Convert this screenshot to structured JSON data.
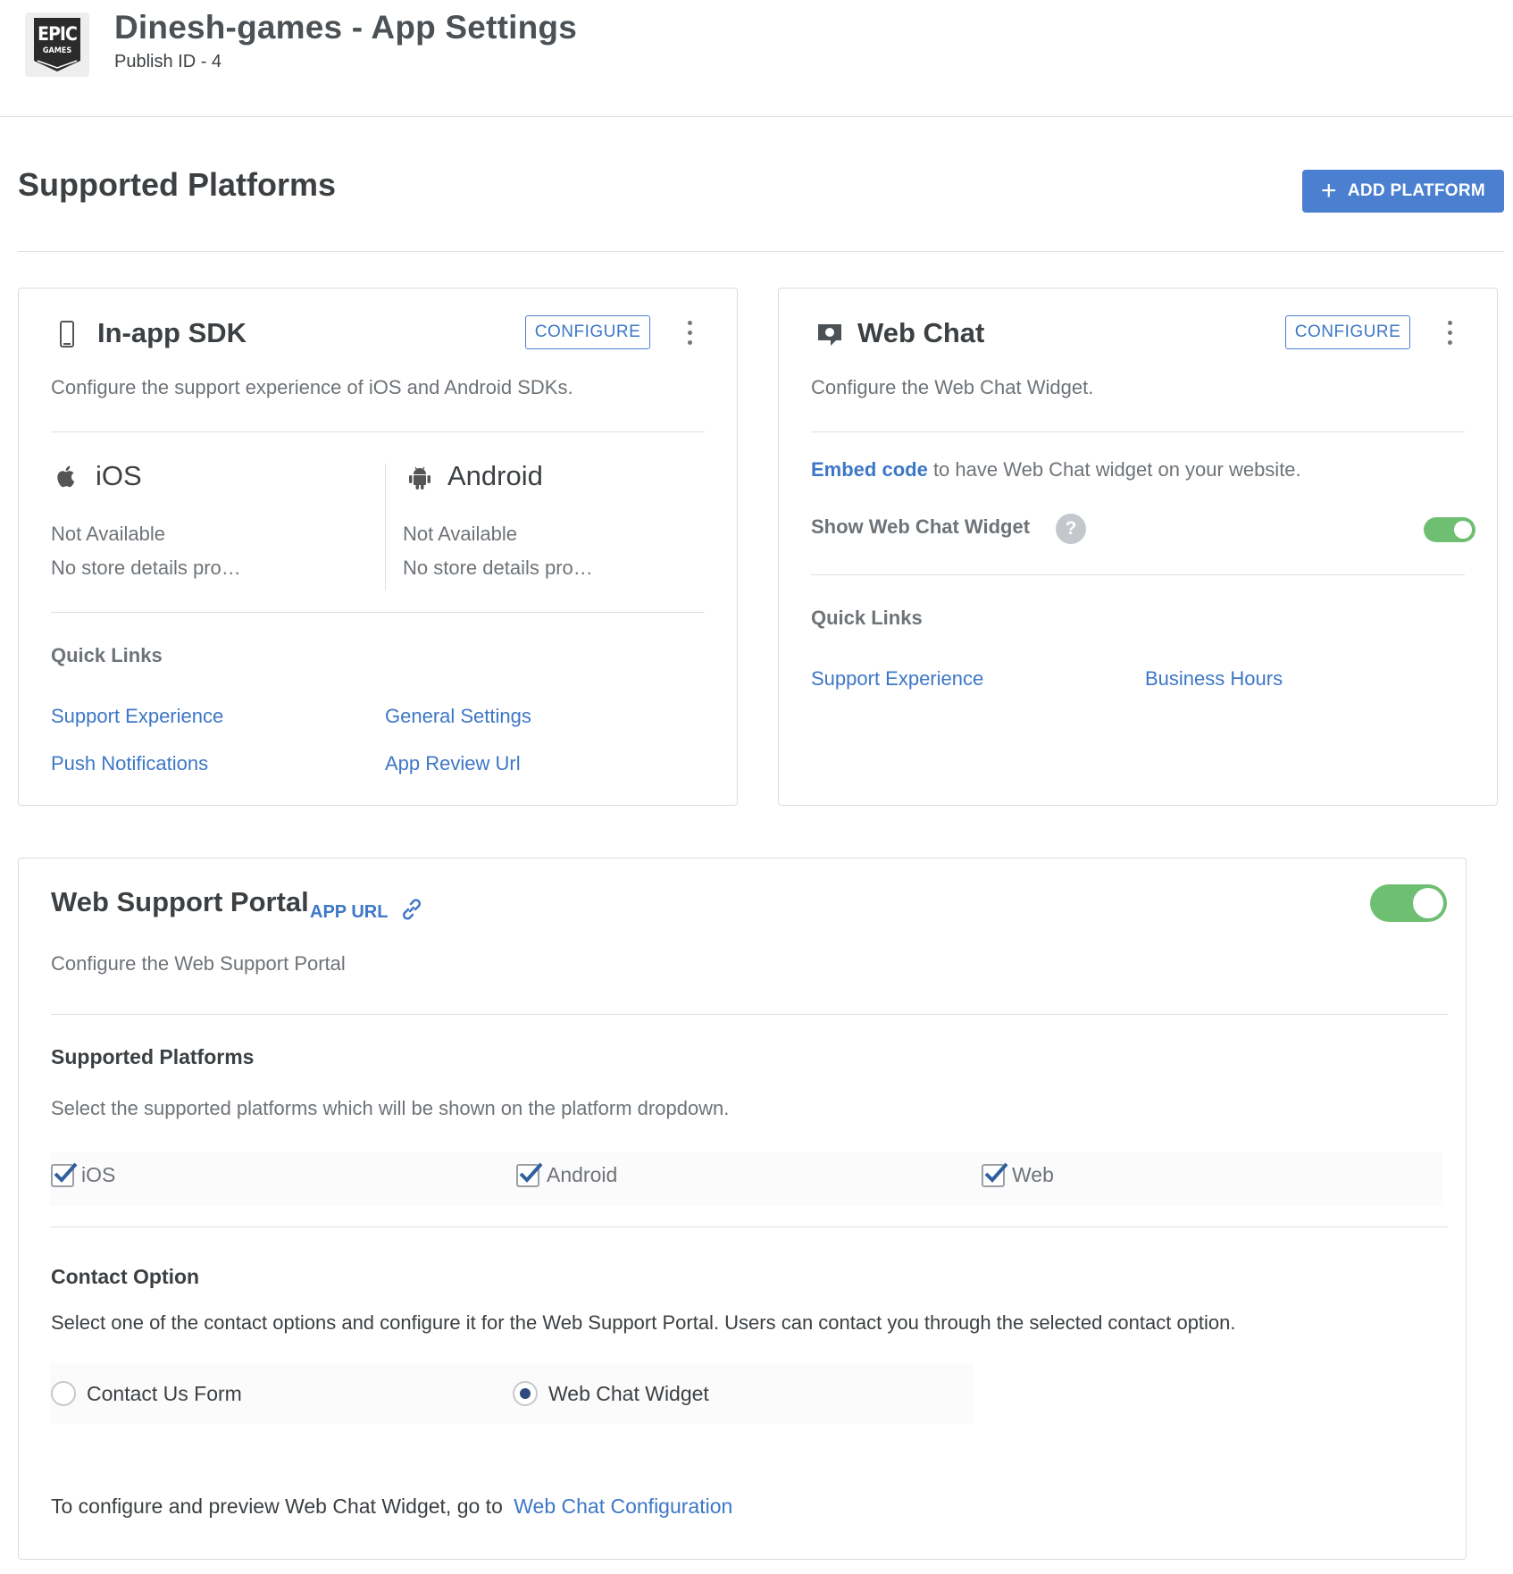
{
  "header": {
    "logo_line1": "EPIC",
    "logo_line2": "GAMES",
    "title": "Dinesh-games - App Settings",
    "subtitle": "Publish ID - 4"
  },
  "platforms": {
    "title": "Supported Platforms",
    "add_button_label": "ADD PLATFORM"
  },
  "inapp_sdk": {
    "icon": "phone-icon",
    "title": "In-app SDK",
    "configure_label": "CONFIGURE",
    "description": "Configure the support experience of iOS and Android SDKs.",
    "ios": {
      "label": "iOS",
      "status": "Not Available",
      "store": "No store details pro…"
    },
    "android": {
      "label": "Android",
      "status": "Not Available",
      "store": "No store details pro…"
    },
    "quick_links_label": "Quick Links",
    "links": [
      "Support Experience",
      "General Settings",
      "Push Notifications",
      "App Review Url"
    ]
  },
  "web_chat": {
    "icon": "chat-icon",
    "title": "Web Chat",
    "configure_label": "CONFIGURE",
    "description": "Configure the Web Chat Widget.",
    "embed_link": "Embed code",
    "embed_text": "to have Web Chat widget on your website.",
    "show_widget_label": "Show Web Chat Widget",
    "show_widget_on": true,
    "quick_links_label": "Quick Links",
    "links": [
      "Support Experience",
      "Business Hours"
    ]
  },
  "web_portal": {
    "title": "Web Support Portal",
    "app_url_label": "APP URL",
    "enabled": true,
    "description": "Configure the Web Support Portal",
    "platforms_title": "Supported Platforms",
    "platforms_desc": "Select the supported platforms which will be shown on the platform dropdown.",
    "platform_options": [
      {
        "label": "iOS",
        "checked": true
      },
      {
        "label": "Android",
        "checked": true
      },
      {
        "label": "Web",
        "checked": true
      }
    ],
    "contact_title": "Contact Option",
    "contact_desc": "Select one of the contact options and configure it for the Web Support Portal. Users can contact you through the selected contact option.",
    "contact_options": [
      {
        "label": "Contact Us Form",
        "selected": false
      },
      {
        "label": "Web Chat Widget",
        "selected": true
      }
    ],
    "footer_text": "To configure and preview Web Chat Widget, go to",
    "footer_link": "Web Chat Configuration"
  },
  "colors": {
    "accent": "#4b80d0",
    "link": "#3d77c7",
    "toggle_on": "#6fbf73"
  }
}
